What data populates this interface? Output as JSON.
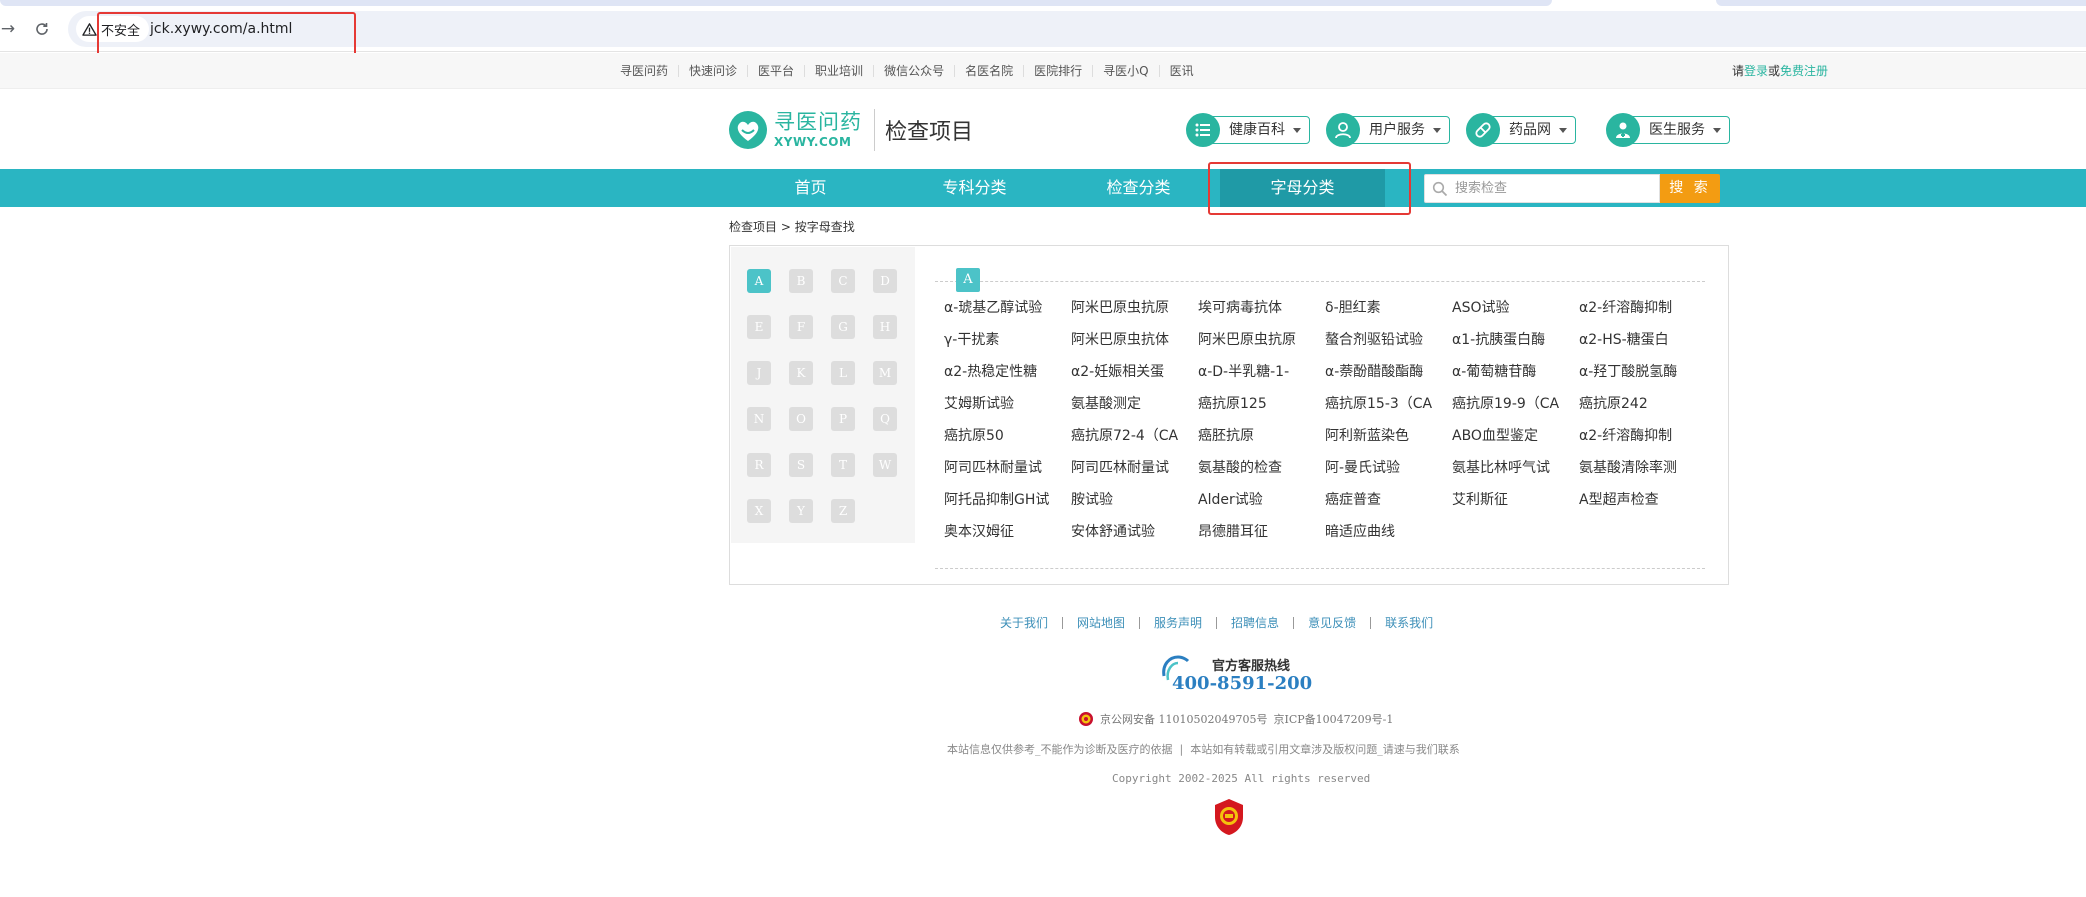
{
  "browser": {
    "security_label": "不安全",
    "url": "jck.xywy.com/a.html"
  },
  "top_links": {
    "items": [
      "寻医问药",
      "快速问诊",
      "医平台",
      "职业培训",
      "微信公众号",
      "名医名院",
      "医院排行",
      "寻医小Q",
      "医讯"
    ],
    "login_prefix": "请",
    "login_label": "登录",
    "login_or": "或",
    "register_label": "免费注册"
  },
  "header": {
    "logo_cn": "寻医问药",
    "logo_en": "XYWY.COM",
    "title": "检查项目",
    "services": [
      "健康百科",
      "用户服务",
      "药品网",
      "医生服务"
    ]
  },
  "nav": {
    "items": [
      "首页",
      "专科分类",
      "检查分类",
      "字母分类"
    ],
    "active_index": 3,
    "search_placeholder": "搜索检查",
    "search_button": "搜 索"
  },
  "breadcrumb": {
    "root": "检查项目",
    "separator": ">",
    "current": "按字母查找"
  },
  "letters": {
    "rows": [
      [
        "A",
        "B",
        "C",
        "D"
      ],
      [
        "E",
        "F",
        "G",
        "H"
      ],
      [
        "J",
        "K",
        "L",
        "M"
      ],
      [
        "N",
        "O",
        "P",
        "Q"
      ],
      [
        "R",
        "S",
        "T",
        "W"
      ],
      [
        "X",
        "Y",
        "Z"
      ]
    ],
    "active": "A"
  },
  "results": {
    "letter": "A",
    "items": [
      "α-琥基乙醇试验",
      "阿米巴原虫抗原",
      "埃可病毒抗体",
      "δ-胆红素",
      "ASO试验",
      "α2-纤溶酶抑制",
      "γ-干扰素",
      "阿米巴原虫抗体",
      "阿米巴原虫抗原",
      "螯合剂驱铅试验",
      "α1-抗胰蛋白酶",
      "α2-HS-糖蛋白",
      "α2-热稳定性糖",
      "α2-妊娠相关蛋",
      "α-D-半乳糖-1-",
      "α-萘酚醋酸酯酶",
      "α-葡萄糖苷酶",
      "α-羟丁酸脱氢酶",
      "艾姆斯试验",
      "氨基酸测定",
      "癌抗原125",
      "癌抗原15-3（CA",
      "癌抗原19-9（CA",
      "癌抗原242",
      "癌抗原50",
      "癌抗原72-4（CA",
      "癌胚抗原",
      "阿利新蓝染色",
      "ABO血型鉴定",
      "α2-纤溶酶抑制",
      "阿司匹林耐量试",
      "阿司匹林耐量试",
      "氨基酸的检查",
      "阿-曼氏试验",
      "氨基比林呼气试",
      "氨基酸清除率测",
      "阿托品抑制GH试",
      "胺试验",
      "Alder试验",
      "癌症普查",
      "艾利斯征",
      "A型超声检查",
      "奥本汉姆征",
      "安体舒通试验",
      "昂德腊耳征",
      "暗适应曲线"
    ]
  },
  "footer": {
    "links": [
      "关于我们",
      "网站地图",
      "服务声明",
      "招聘信息",
      "意见反馈",
      "联系我们"
    ],
    "hotline_label": "官方客服热线",
    "hotline_number": "400-8591-200",
    "icp_police": "京公网安备 11010502049705号",
    "icp_record": "京ICP备10047209号-1",
    "disclaimer": "本站信息仅供参考_不能作为诊断及医疗的依据  |  本站如有转载或引用文章涉及版权问题_请速与我们联系",
    "copyright": "Copyright 2002-2025 All rights reserved"
  },
  "colors": {
    "teal_nav": "#2ab5c2",
    "brand_green": "#2ab5a0",
    "search_orange": "#f39c12",
    "highlight_red": "#e53935",
    "hotline_blue": "#2b7fc1"
  }
}
